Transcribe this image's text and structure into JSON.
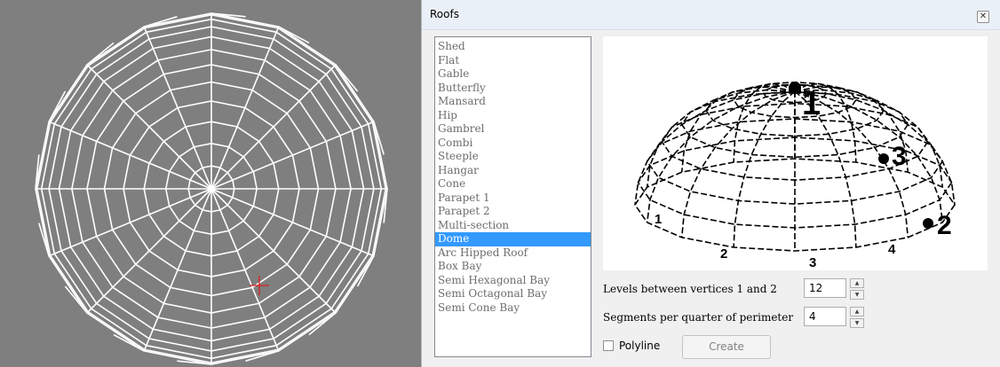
{
  "window": {
    "title": "Roofs"
  },
  "title_bar": {
    "close_glyph": "✕"
  },
  "roof_types": [
    "Shed",
    "Flat",
    "Gable",
    "Butterfly",
    "Mansard",
    "Hip",
    "Gambrel",
    "Combi",
    "Steeple",
    "Hangar",
    "Cone",
    "Parapet 1",
    "Parapet 2",
    "Multi-section",
    "Dome",
    "Arc Hipped Roof",
    "Box Bay",
    "Semi Hexagonal Bay",
    "Semi Octagonal Bay",
    "Semi Cone Bay"
  ],
  "selected_roof": "Dome",
  "preview": {
    "vertex_labels": {
      "v1": "1",
      "v2": "2",
      "v3": "3"
    },
    "edge_labels": {
      "e1": "1",
      "e2": "2",
      "e3": "3",
      "e4": "4"
    }
  },
  "fields": {
    "levels": {
      "label": "Levels between vertices 1 and 2",
      "value": "12"
    },
    "segments": {
      "label": "Segments per quarter of perimeter",
      "value": "4"
    }
  },
  "polyline": {
    "label": "Polyline",
    "checked": false
  },
  "create_button": {
    "label": "Create"
  },
  "colors": {
    "viewport_bg": "#7f7f7f",
    "selection": "#3399ff",
    "cursor": "#e02020"
  }
}
